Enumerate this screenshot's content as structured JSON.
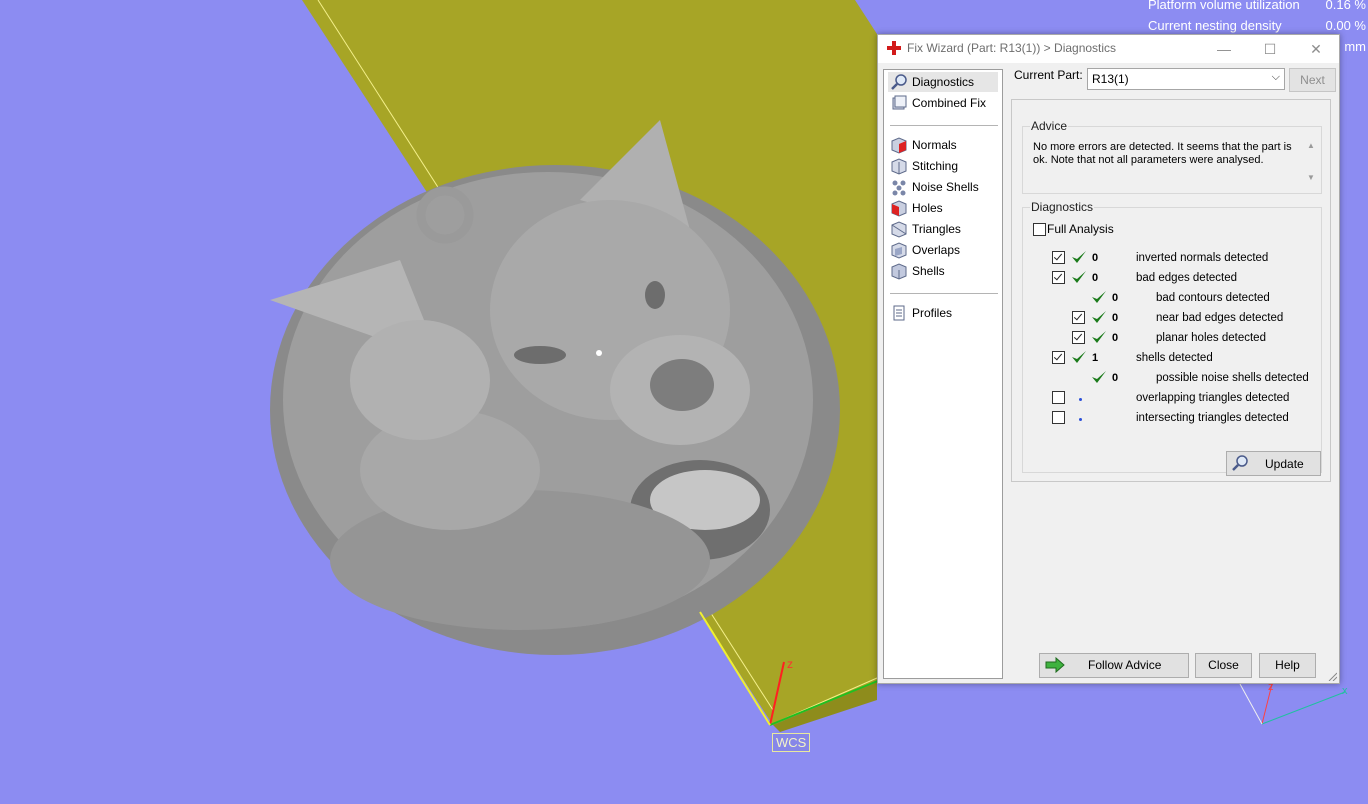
{
  "viewport": {
    "stats": [
      {
        "label": "Platform volume utilization",
        "value": "0.16 %"
      },
      {
        "label": "Current nesting density",
        "value": "0.00 %"
      },
      {
        "label": "",
        "value": "mm"
      }
    ],
    "wcs_label": "WCS",
    "axis_z": "z",
    "axis_z_small": "z",
    "axis_x_small": "x",
    "axis_y_small": "y"
  },
  "dialog": {
    "title": "Fix Wizard (Part: R13(1)) > Diagnostics",
    "nav": {
      "items": [
        {
          "label": "Diagnostics",
          "icon": "magnifier-icon",
          "selected": true
        },
        {
          "label": "Combined Fix",
          "icon": "combined-fix-icon"
        },
        {
          "label": "Normals",
          "icon": "normals-icon"
        },
        {
          "label": "Stitching",
          "icon": "stitching-icon"
        },
        {
          "label": "Noise Shells",
          "icon": "noise-shells-icon"
        },
        {
          "label": "Holes",
          "icon": "holes-icon"
        },
        {
          "label": "Triangles",
          "icon": "triangles-icon"
        },
        {
          "label": "Overlaps",
          "icon": "overlaps-icon"
        },
        {
          "label": "Shells",
          "icon": "shells-icon"
        },
        {
          "label": "Profiles",
          "icon": "profiles-icon"
        }
      ]
    },
    "current_part_label": "Current Part:",
    "current_part_value": "R13(1)",
    "next_label": "Next",
    "advice": {
      "legend": "Advice",
      "text": "No more errors are detected. It seems that the part is ok. Note that not all parameters were analysed."
    },
    "diagnostics": {
      "legend": "Diagnostics",
      "full_analysis_label": "Full Analysis",
      "full_analysis_checked": false,
      "rows": [
        {
          "checked": true,
          "status": "ok",
          "count": "0",
          "text": "inverted normals detected",
          "indent": 0
        },
        {
          "checked": true,
          "status": "ok",
          "count": "0",
          "text": "bad edges detected",
          "indent": 0
        },
        {
          "checked": null,
          "status": "ok",
          "count": "0",
          "text": "bad contours detected",
          "indent": 1
        },
        {
          "checked": true,
          "status": "ok",
          "count": "0",
          "text": "near bad edges detected",
          "indent": 1
        },
        {
          "checked": true,
          "status": "ok",
          "count": "0",
          "text": "planar holes detected",
          "indent": 1
        },
        {
          "checked": true,
          "status": "ok",
          "count": "1",
          "text": "shells detected",
          "indent": 0
        },
        {
          "checked": null,
          "status": "ok",
          "count": "0",
          "text": "possible noise shells detected",
          "indent": 1
        },
        {
          "checked": false,
          "status": "pending",
          "count": "",
          "text": "overlapping triangles detected",
          "indent": 0
        },
        {
          "checked": false,
          "status": "pending",
          "count": "",
          "text": "intersecting triangles detected",
          "indent": 0
        }
      ],
      "update_label": "Update"
    },
    "footer": {
      "follow_advice_label": "Follow Advice",
      "close_label": "Close",
      "help_label": "Help"
    }
  },
  "colors": {
    "background": "#8c8cf2",
    "platform": "#a7a526",
    "check_green": "#1a7a1a",
    "pending_dot": "#2b4fd9"
  }
}
